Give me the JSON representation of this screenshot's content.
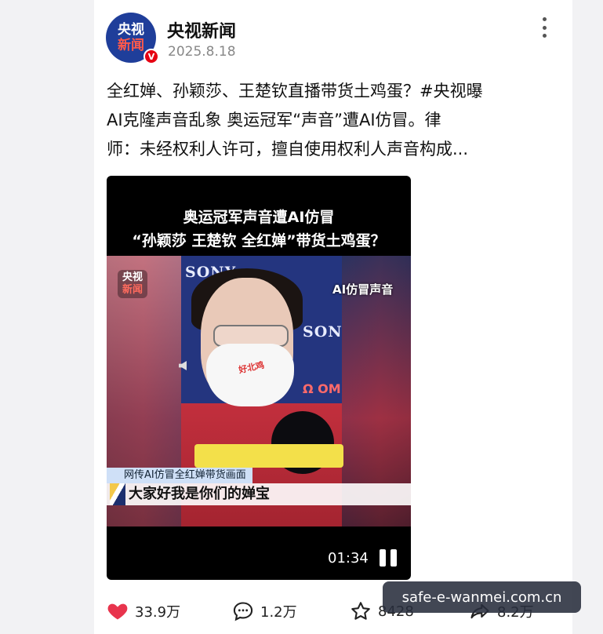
{
  "account": {
    "avatar_line1": "央视",
    "avatar_line2": "新闻",
    "verified_mark": "V",
    "name": "央视新闻",
    "date": "2025.8.18"
  },
  "post": {
    "line1": "全红婵、孙颖莎、王楚钦直播带货土鸡蛋？#央视曝",
    "line2": "AI克隆声音乱象 奥运冠军“声音”遭AI仿冒。律",
    "line3": "师：未经权利人许可，擅自使用权利人声音构成..."
  },
  "video": {
    "title_line1": "奥运冠军声音遭AI仿冒",
    "title_line2": "“孙颖莎 王楚钦 全红婵”带货土鸡蛋？",
    "logo_line1": "央视",
    "logo_line2": "新闻",
    "ai_badge": "AI仿冒声音",
    "sponsor_1": "SONY",
    "sponsor_2": "SON",
    "sponsor_3": "Ω OM",
    "mask_text": "好北鸡",
    "caption_label": "网传AI仿冒全红婵带货画面",
    "caption_main": "大家好我是你们的婵宝",
    "duration": "01:34"
  },
  "actions": {
    "likes": "33.9万",
    "comments": "1.2万",
    "favorites": "8428",
    "shares": "8.2万"
  },
  "watermark": "safe-e-wanmei.com.cn",
  "colors": {
    "brand_blue": "#1f3e9a",
    "like_red": "#e8344d",
    "verified_red": "#e60012"
  }
}
